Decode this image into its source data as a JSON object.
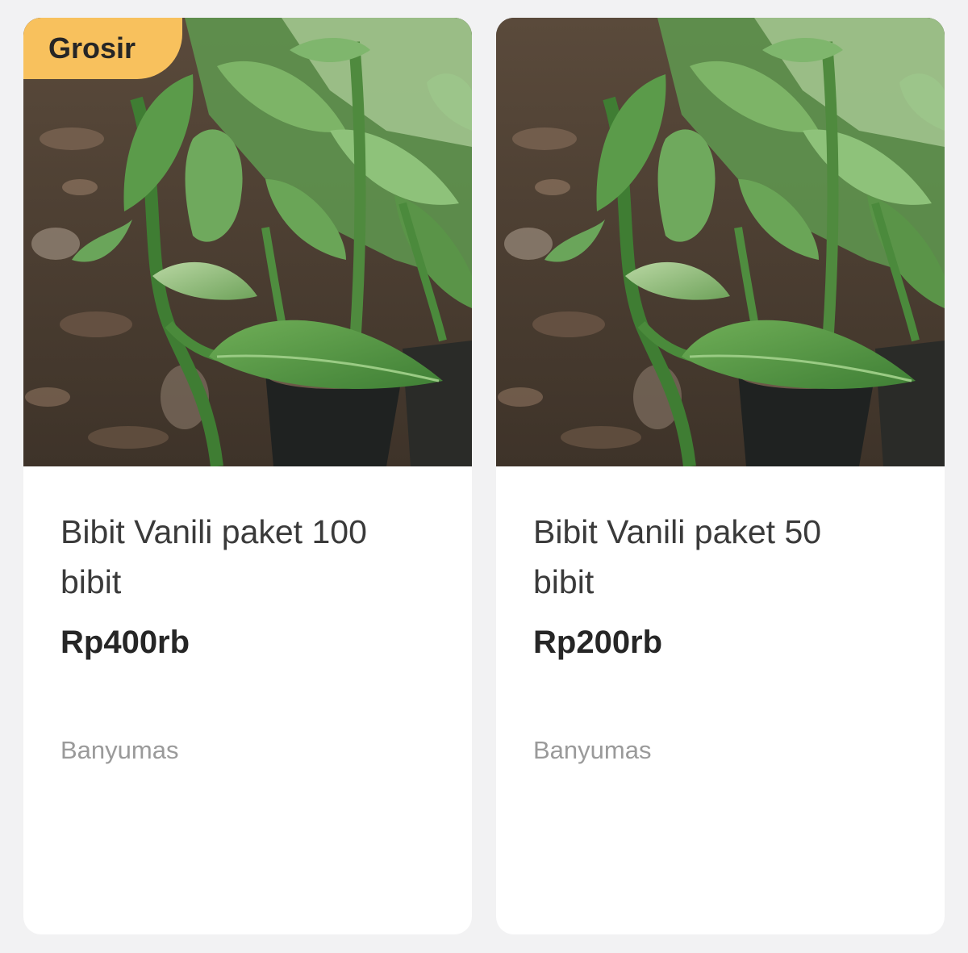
{
  "listings": [
    {
      "badge": "Grosir",
      "title": "Bibit Vanili paket 100 bibit",
      "price": "Rp400rb",
      "location": "Banyumas",
      "image": "vanilla-seedlings-photo"
    },
    {
      "title": "Bibit Vanili paket 50 bibit",
      "price": "Rp200rb",
      "location": "Banyumas",
      "image": "vanilla-seedlings-photo"
    }
  ],
  "colors": {
    "badge_bg": "#f8c15d",
    "page_bg": "#f2f2f3",
    "card_bg": "#ffffff",
    "title_text": "#3a3a3a",
    "location_text": "#9a9a9a"
  }
}
